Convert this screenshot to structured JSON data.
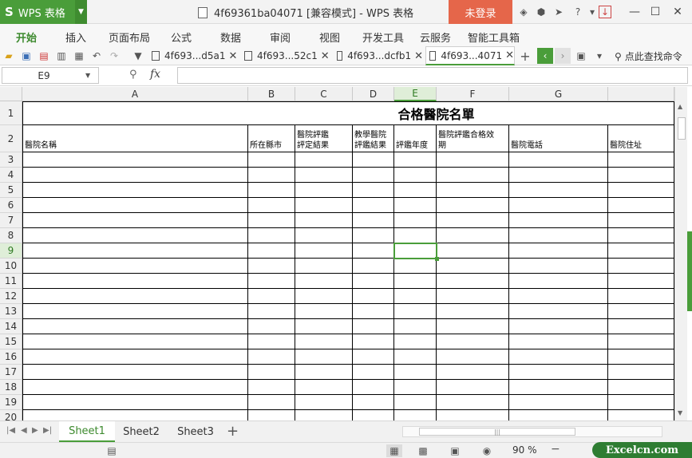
{
  "titlebar": {
    "app_logo": "S",
    "app_name": "WPS 表格",
    "document_title": "4f69361ba04071 [兼容模式] - WPS 表格",
    "login": "未登录"
  },
  "menu": [
    "开始",
    "插入",
    "页面布局",
    "公式",
    "数据",
    "审阅",
    "视图",
    "开发工具",
    "云服务",
    "智能工具箱"
  ],
  "doc_tabs": [
    {
      "label": "4f693...d5a1"
    },
    {
      "label": "4f693...52c1"
    },
    {
      "label": "4f693...dcfb1"
    },
    {
      "label": "4f693...4071"
    }
  ],
  "find_label": "点此查找命令",
  "formula_bar": {
    "name_box": "E9",
    "fx": "fx",
    "value": ""
  },
  "columns": [
    "A",
    "B",
    "C",
    "D",
    "E",
    "F",
    "G"
  ],
  "rows": [
    "1",
    "2",
    "3",
    "4",
    "5",
    "6",
    "7",
    "8",
    "9",
    "10",
    "11",
    "12",
    "13",
    "14",
    "15",
    "16",
    "17",
    "18",
    "19",
    "20"
  ],
  "sheet": {
    "title": "合格醫院名單",
    "headers": [
      "醫院名稱",
      "所在縣市",
      "醫院評鑑\n評定結果",
      "教學醫院\n評鑑結果",
      "評鑑年度",
      "醫院評鑑合格效\n期",
      "醫院電話",
      "醫院住址"
    ]
  },
  "selected_cell": {
    "column": "E",
    "row": "9"
  },
  "sheet_tabs": [
    "Sheet1",
    "Sheet2",
    "Sheet3"
  ],
  "active_sheet": "Sheet1",
  "status": {
    "zoom": "90 %"
  },
  "brand": "Excelcn.com",
  "colors": {
    "accent": "#4a9d3a",
    "login_bg": "#e5664a"
  }
}
